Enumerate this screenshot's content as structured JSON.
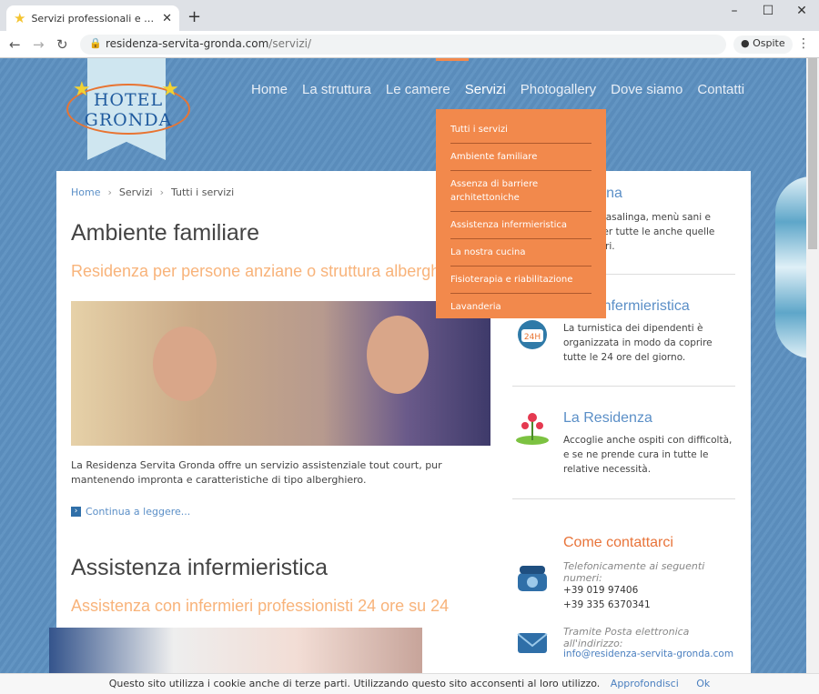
{
  "browser": {
    "tab_title": "Servizi professionali e completi c",
    "url_host": "residenza-servita-gronda.com",
    "url_path": "/servizi/",
    "guest_label": "Ospite"
  },
  "site": {
    "logo_line1": "HOTEL",
    "logo_line2": "GRONDA",
    "nav": [
      "Home",
      "La struttura",
      "Le camere",
      "Servizi",
      "Photogallery",
      "Dove siamo",
      "Contatti"
    ],
    "dropdown": [
      "Tutti i servizi",
      "Ambiente familiare",
      "Assenza di barriere architettoniche",
      "Assistenza infermieristica",
      "La nostra cucina",
      "Fisioterapia e riabilitazione",
      "Lavanderia"
    ],
    "breadcrumb": [
      "Home",
      "Servizi",
      "Tutti i servizi"
    ],
    "article1": {
      "title": "Ambiente familiare",
      "subtitle": "Residenza per persone anziane o struttura alberghiera?",
      "text": "La Residenza Servita Gronda offre un servizio assistenziale tout court, pur mantenendo impronta e caratteristiche di tipo alberghiero.",
      "more": "Continua a leggere..."
    },
    "article2": {
      "title": "Assistenza infermieristica",
      "subtitle": "Assistenza con infermieri professionisti 24 ore su 24"
    },
    "sidebar": {
      "item1_title": "ra cucina",
      "item1_text": "terna e casalinga, menù sani e variati per tutte le anche quelle particolari.",
      "item2_title": "enza Infermieristica",
      "item2_text": "La turnistica dei dipendenti è organizzata in modo da coprire tutte le 24 ore del giorno.",
      "item3_title": "La Residenza",
      "item3_text": "Accoglie anche ospiti con difficoltà, e se ne prende cura in tutte le relative necessità.",
      "contact_title": "Come contattarci",
      "phone_label": "Telefonicamente ai seguenti numeri:",
      "phone1": "+39 019 97406",
      "phone2": "+39 335 6370341",
      "mail_label": "Tramite Posta elettronica all'indirizzo:",
      "email": "info@residenza-servita-gronda.com"
    },
    "cookie": {
      "text": "Questo sito utilizza i cookie anche di terze parti. Utilizzando questo sito acconsenti al loro utilizzo.",
      "more": "Approfondisci",
      "ok": "Ok"
    }
  }
}
